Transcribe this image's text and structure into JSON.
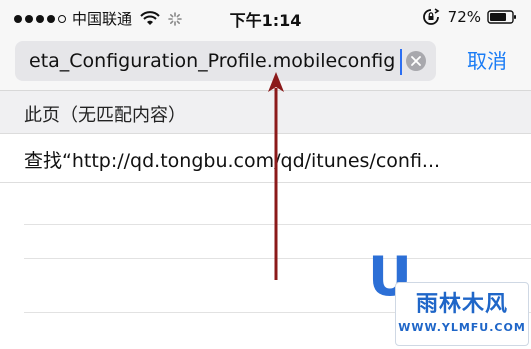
{
  "status_bar": {
    "carrier": "中国联通",
    "time": "下午1:14",
    "battery": "72%"
  },
  "search": {
    "value": "eta_Configuration_Profile.mobileconfig",
    "cancel_label": "取消"
  },
  "results": {
    "section_header": "此页（无匹配内容）",
    "find_item": "查找“http://qd.tongbu.com/qd/itunes/confi..."
  },
  "watermark": {
    "big_letter": "U",
    "badge_text": "雨林木风",
    "badge_url": "WWW.YLMFU.COM"
  },
  "colors": {
    "accent": "#1a7cf5",
    "arrow": "#8b1a1a"
  }
}
